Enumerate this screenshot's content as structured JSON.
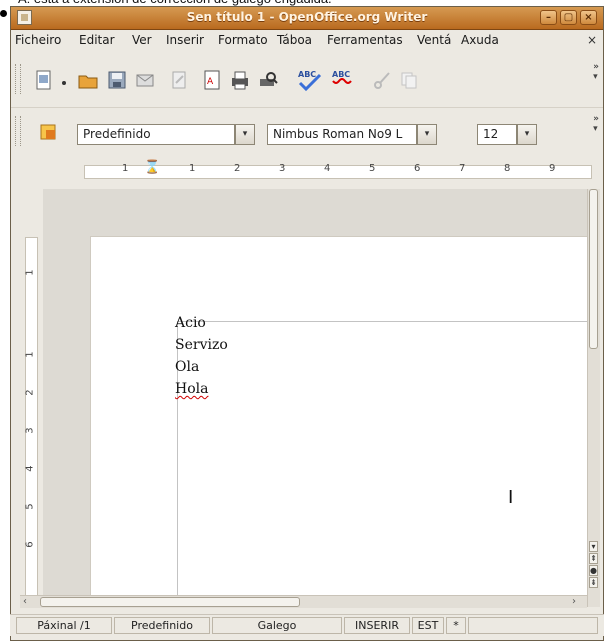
{
  "caption": "A: esta a extensión de corrección de galego engadida.",
  "window": {
    "title": "Sen título 1 - OpenOffice.org Writer",
    "controls": [
      "–",
      "▢",
      "×"
    ]
  },
  "menu": {
    "items": [
      "Ficheiro",
      "Editar",
      "Ver",
      "Inserir",
      "Formato",
      "Táboa",
      "Ferramentas",
      "Ventá",
      "Axuda"
    ],
    "close": "×"
  },
  "formatting": {
    "style_value": "Predefinido",
    "font_value": "Nimbus Roman No9 L",
    "size_value": "12"
  },
  "ruler": {
    "h_numbers": [
      "1",
      "1",
      "2",
      "3",
      "4",
      "5",
      "6",
      "7",
      "8",
      "9"
    ],
    "v_numbers": [
      "1",
      "1",
      "2",
      "3",
      "4",
      "5",
      "6"
    ],
    "tab_stop": "L"
  },
  "document": {
    "lines": [
      "Acio",
      "Servizo",
      "Ola",
      "Hola"
    ],
    "misspelled_line": "Hola"
  },
  "statusbar": {
    "page": "Páxinal /1",
    "style": "Predefinido",
    "language": "Galego",
    "mode": "INSERIR",
    "selection": "EST",
    "modified": "*"
  },
  "icons": [
    "new-document-icon",
    "open-folder-icon",
    "save-icon",
    "email-icon",
    "edit-file-icon",
    "export-pdf-icon",
    "print-icon",
    "print-preview-icon",
    "spellcheck-icon",
    "autospellcheck-icon",
    "cut-icon",
    "copy-icon",
    "styles-icon"
  ]
}
